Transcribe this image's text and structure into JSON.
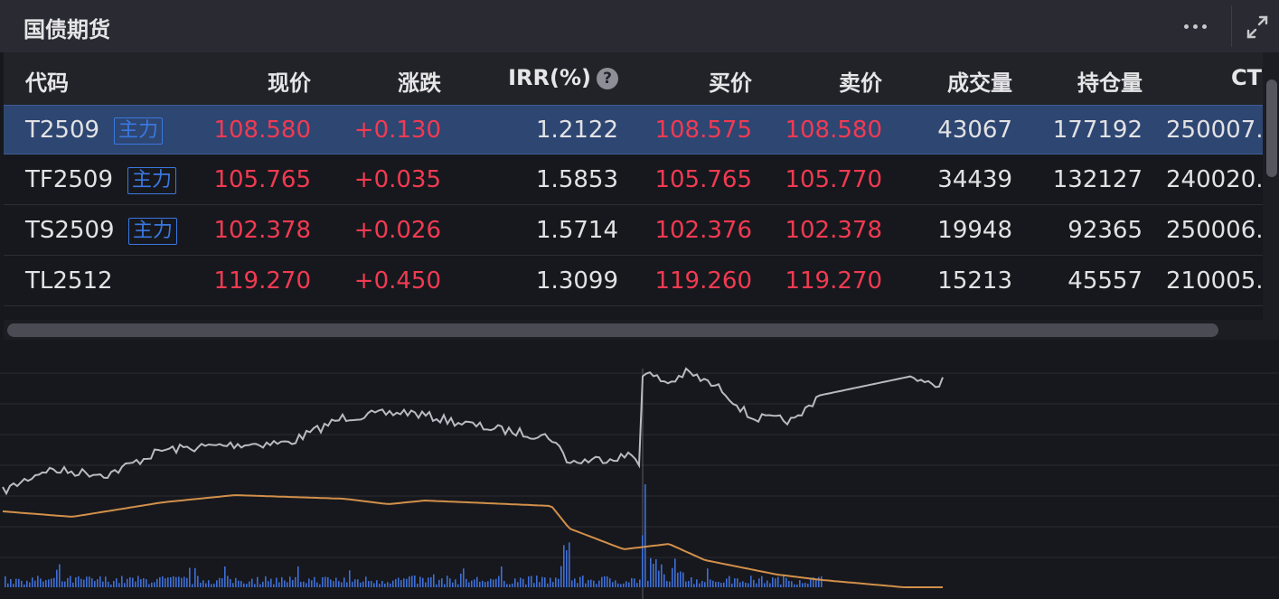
{
  "panel": {
    "title": "国债期货"
  },
  "columns": [
    "代码",
    "现价",
    "涨跌",
    "IRR(%)",
    "买价",
    "卖价",
    "成交量",
    "持仓量",
    "CT"
  ],
  "irr_help_icon": "?",
  "rows": [
    {
      "code": "T2509",
      "badge": "主力",
      "price": "108.580",
      "change": "+0.130",
      "irr": "1.2122",
      "bid": "108.575",
      "ask": "108.580",
      "volume": "43067",
      "oi": "177192",
      "ct": "250007."
    },
    {
      "code": "TF2509",
      "badge": "主力",
      "price": "105.765",
      "change": "+0.035",
      "irr": "1.5853",
      "bid": "105.765",
      "ask": "105.770",
      "volume": "34439",
      "oi": "132127",
      "ct": "240020."
    },
    {
      "code": "TS2509",
      "badge": "主力",
      "price": "102.378",
      "change": "+0.026",
      "irr": "1.5714",
      "bid": "102.376",
      "ask": "102.378",
      "volume": "19948",
      "oi": "92365",
      "ct": "250006."
    },
    {
      "code": "TL2512",
      "badge": "",
      "price": "119.270",
      "change": "+0.450",
      "irr": "1.3099",
      "bid": "119.260",
      "ask": "119.270",
      "volume": "15213",
      "oi": "45557",
      "ct": "210005."
    }
  ],
  "colors": {
    "up": "#f23a52",
    "price_line": "#b9bac2",
    "avg_line": "#d2904a",
    "volume_bar": "#3f6fd6",
    "selected_row": "#2e4672"
  },
  "icons": [
    "more-icon",
    "expand-icon",
    "help-icon"
  ]
}
